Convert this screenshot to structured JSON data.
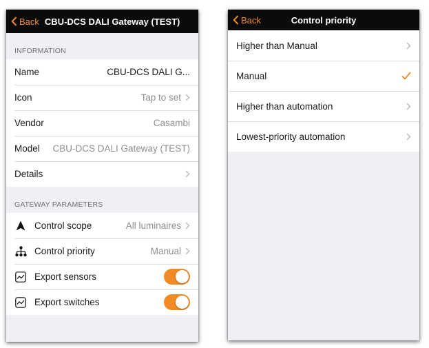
{
  "colors": {
    "accent": "#f08a24",
    "navbar": "#0b0b0b",
    "background": "#efeff4"
  },
  "left": {
    "navbar": {
      "back_label": "Back",
      "title": "CBU-DCS DALI Gateway (TEST)"
    },
    "information": {
      "header": "INFORMATION",
      "name_label": "Name",
      "name_value": "CBU-DCS DALI G...",
      "icon_label": "Icon",
      "icon_value": "Tap to set",
      "vendor_label": "Vendor",
      "vendor_value": "Casambi",
      "model_label": "Model",
      "model_value": "CBU-DCS DALI Gateway (TEST)",
      "details_label": "Details"
    },
    "gateway": {
      "header": "GATEWAY PARAMETERS",
      "scope_label": "Control scope",
      "scope_value": "All luminaires",
      "scope_icon": "arrow-up-icon",
      "priority_label": "Control priority",
      "priority_value": "Manual",
      "priority_icon": "hierarchy-icon",
      "sensors_label": "Export sensors",
      "sensors_on": true,
      "sensors_icon": "chart-icon",
      "switches_label": "Export switches",
      "switches_on": true,
      "switches_icon": "chart-icon"
    }
  },
  "right": {
    "navbar": {
      "back_label": "Back",
      "title": "Control priority"
    },
    "options": [
      {
        "label": "Higher than Manual",
        "selected": false
      },
      {
        "label": "Manual",
        "selected": true
      },
      {
        "label": "Higher than automation",
        "selected": false
      },
      {
        "label": "Lowest-priority automation",
        "selected": false
      }
    ]
  }
}
